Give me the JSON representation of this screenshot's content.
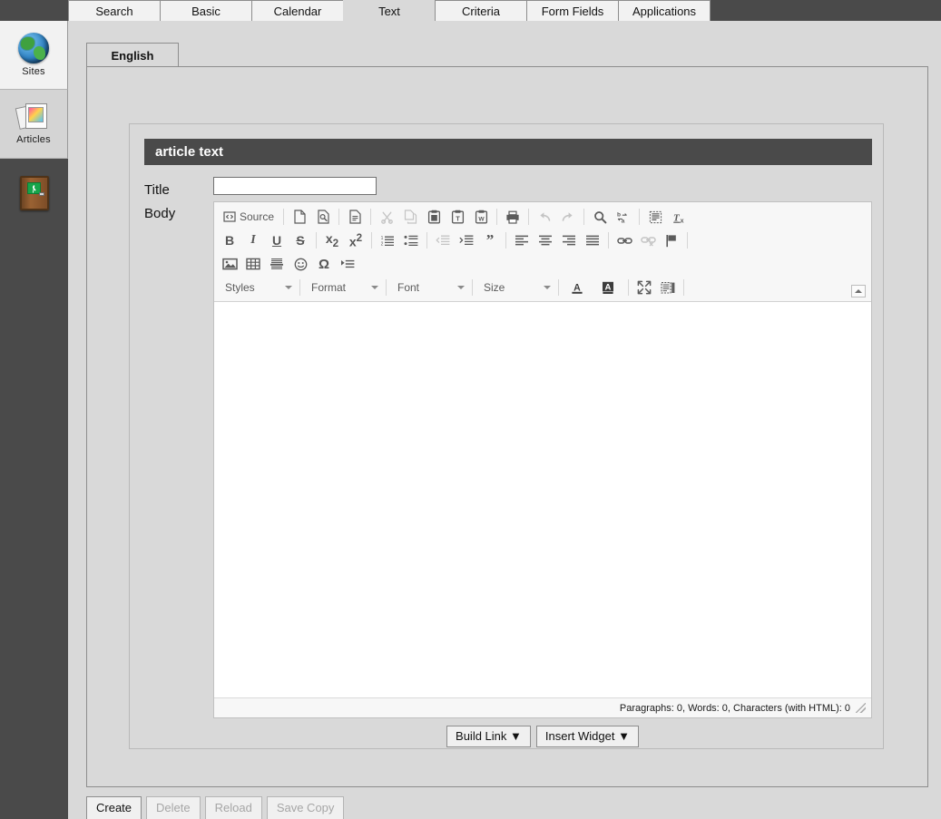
{
  "sidebar": {
    "items": [
      {
        "label": "Sites",
        "icon": "globe-icon",
        "active": true
      },
      {
        "label": "Articles",
        "icon": "photos-icon",
        "active": false
      },
      {
        "label": "",
        "icon": "exit-door-icon",
        "active": false
      }
    ]
  },
  "top_tabs": [
    {
      "label": "Search",
      "active": false
    },
    {
      "label": "Basic",
      "active": false
    },
    {
      "label": "Calendar",
      "active": false
    },
    {
      "label": "Text",
      "active": true
    },
    {
      "label": "Criteria",
      "active": false
    },
    {
      "label": "Form Fields",
      "active": false
    },
    {
      "label": "Applications",
      "active": false
    }
  ],
  "language_tabs": [
    {
      "label": "English",
      "active": true
    }
  ],
  "form": {
    "header": "article text",
    "title_label": "Title",
    "title_value": "",
    "title_placeholder": "",
    "body_label": "Body"
  },
  "editor": {
    "toolbar": {
      "row1": [
        {
          "name": "source-button",
          "label": "Source",
          "icon": "source-icon",
          "disabled": false
        },
        {
          "sep": true
        },
        {
          "name": "new-page-button",
          "label": "",
          "icon": "new-page-icon",
          "disabled": false
        },
        {
          "name": "preview-button",
          "label": "",
          "icon": "preview-icon",
          "disabled": false
        },
        {
          "sep": true
        },
        {
          "name": "templates-button",
          "label": "",
          "icon": "templates-icon",
          "disabled": false
        },
        {
          "sep": true
        },
        {
          "name": "cut-button",
          "label": "",
          "icon": "scissors-icon",
          "disabled": true
        },
        {
          "name": "copy-button",
          "label": "",
          "icon": "copy-icon",
          "disabled": true
        },
        {
          "name": "paste-button",
          "label": "",
          "icon": "paste-icon",
          "disabled": false
        },
        {
          "name": "paste-as-text-button",
          "label": "",
          "icon": "paste-text-icon",
          "disabled": false
        },
        {
          "name": "paste-from-word-button",
          "label": "",
          "icon": "paste-word-icon",
          "disabled": false
        },
        {
          "sep": true
        },
        {
          "name": "print-button",
          "label": "",
          "icon": "printer-icon",
          "disabled": false
        },
        {
          "sep": true
        },
        {
          "name": "undo-button",
          "label": "",
          "icon": "undo-arrow-icon",
          "disabled": true
        },
        {
          "name": "redo-button",
          "label": "",
          "icon": "redo-arrow-icon",
          "disabled": true
        },
        {
          "sep": true
        },
        {
          "name": "find-button",
          "label": "",
          "icon": "magnifier-icon",
          "disabled": false
        },
        {
          "name": "replace-button",
          "label": "",
          "icon": "replace-icon",
          "disabled": false
        },
        {
          "sep": true
        },
        {
          "name": "select-all-button",
          "label": "",
          "icon": "select-all-icon",
          "disabled": false
        },
        {
          "name": "remove-format-button",
          "label": "",
          "icon": "remove-format-icon",
          "disabled": false
        }
      ],
      "row2": [
        {
          "name": "bold-button",
          "label": "B",
          "icon": "bold-icon",
          "disabled": false
        },
        {
          "name": "italic-button",
          "label": "I",
          "icon": "italic-icon",
          "disabled": false
        },
        {
          "name": "underline-button",
          "label": "U",
          "icon": "underline-icon",
          "disabled": false
        },
        {
          "name": "strikethrough-button",
          "label": "S",
          "icon": "strikethrough-icon",
          "disabled": false
        },
        {
          "sep": true
        },
        {
          "name": "subscript-button",
          "label": "x",
          "icon": "subscript-icon",
          "disabled": false
        },
        {
          "name": "superscript-button",
          "label": "x",
          "icon": "superscript-icon",
          "disabled": false
        },
        {
          "sep": true
        },
        {
          "name": "numbered-list-button",
          "label": "",
          "icon": "numbered-list-icon",
          "disabled": false
        },
        {
          "name": "bulleted-list-button",
          "label": "",
          "icon": "bulleted-list-icon",
          "disabled": false
        },
        {
          "sep": true
        },
        {
          "name": "outdent-button",
          "label": "",
          "icon": "outdent-icon",
          "disabled": true
        },
        {
          "name": "indent-button",
          "label": "",
          "icon": "indent-icon",
          "disabled": false
        },
        {
          "name": "blockquote-button",
          "label": "",
          "icon": "quote-icon",
          "disabled": false
        },
        {
          "sep": true
        },
        {
          "name": "align-left-button",
          "label": "",
          "icon": "align-left-icon",
          "disabled": false
        },
        {
          "name": "align-center-button",
          "label": "",
          "icon": "align-center-icon",
          "disabled": false
        },
        {
          "name": "align-right-button",
          "label": "",
          "icon": "align-right-icon",
          "disabled": false
        },
        {
          "name": "align-justify-button",
          "label": "",
          "icon": "align-justify-icon",
          "disabled": false
        },
        {
          "sep": true
        },
        {
          "name": "link-button",
          "label": "",
          "icon": "link-icon",
          "disabled": false
        },
        {
          "name": "unlink-button",
          "label": "",
          "icon": "unlink-icon",
          "disabled": true
        },
        {
          "name": "anchor-button",
          "label": "",
          "icon": "flag-icon",
          "disabled": false
        },
        {
          "sep": true
        }
      ],
      "row3": [
        {
          "name": "image-button",
          "label": "",
          "icon": "image-icon",
          "disabled": false
        },
        {
          "name": "table-button",
          "label": "",
          "icon": "table-icon",
          "disabled": false
        },
        {
          "name": "horizontal-rule-button",
          "label": "",
          "icon": "horizontal-rule-icon",
          "disabled": false
        },
        {
          "name": "smiley-button",
          "label": "",
          "icon": "smiley-icon",
          "disabled": false
        },
        {
          "name": "special-character-button",
          "label": "Ω",
          "icon": "omega-icon",
          "disabled": false
        },
        {
          "name": "page-break-button",
          "label": "",
          "icon": "page-break-icon",
          "disabled": false
        }
      ],
      "combos": [
        {
          "name": "styles-combo",
          "label": "Styles"
        },
        {
          "name": "format-combo",
          "label": "Format"
        },
        {
          "name": "font-combo",
          "label": "Font"
        },
        {
          "name": "size-combo",
          "label": "Size"
        }
      ],
      "row4_buttons": [
        {
          "name": "text-color-button",
          "label": "A",
          "icon": "text-color-icon",
          "disabled": false
        },
        {
          "name": "background-color-button",
          "label": "A",
          "icon": "background-color-icon",
          "disabled": false
        },
        {
          "sep": true
        },
        {
          "name": "maximize-button",
          "label": "",
          "icon": "maximize-icon",
          "disabled": false
        },
        {
          "name": "show-blocks-button",
          "label": "",
          "icon": "show-blocks-icon",
          "disabled": false
        },
        {
          "sep": true
        },
        {
          "name": "about-button",
          "label": "?",
          "icon": "question-mark-icon",
          "disabled": false
        }
      ]
    },
    "content": "",
    "status": "Paragraphs: 0, Words: 0, Characters (with HTML): 0"
  },
  "editor_actions": [
    {
      "label": "Build Link ▼",
      "name": "build-link-button",
      "disabled": false
    },
    {
      "label": "Insert Widget ▼",
      "name": "insert-widget-button",
      "disabled": false
    }
  ],
  "action_bar": [
    {
      "label": "Create",
      "name": "create-button",
      "disabled": false
    },
    {
      "label": "Delete",
      "name": "delete-button",
      "disabled": true
    },
    {
      "label": "Reload",
      "name": "reload-button",
      "disabled": true
    },
    {
      "label": "Save Copy",
      "name": "save-copy-button",
      "disabled": true
    }
  ],
  "colors": {
    "chrome_dark": "#4a4a4a",
    "page_bg": "#d9d9d9",
    "tab_inactive": "#f2f2f2",
    "header_bar": "#4a4a4a",
    "editor_bg": "#ffffff"
  }
}
